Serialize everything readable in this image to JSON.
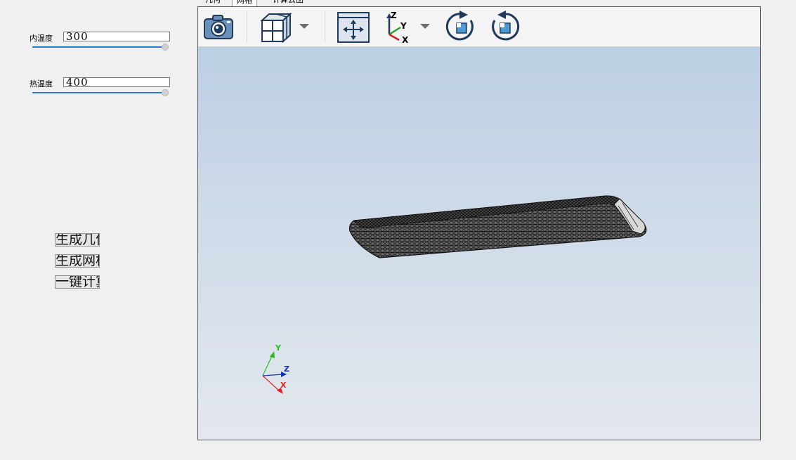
{
  "params": {
    "inner_temp": {
      "label": "内温度",
      "value": "300",
      "slider_level": 1.0
    },
    "hot_temp": {
      "label": "热温度",
      "value": "400",
      "slider_level": 1.0
    }
  },
  "buttons": {
    "generate_geometry": "生成几何",
    "generate_mesh": "生成网格",
    "one_click_compute": "一键计算"
  },
  "tabs": [
    "几何",
    "网格",
    "计算云图"
  ],
  "active_tab": 1,
  "toolbar": {
    "icons": [
      "camera-icon",
      "view-cube-icon",
      "dropdown-icon",
      "fit-view-icon",
      "axes-icon",
      "dropdown-icon",
      "rotate-cw-icon",
      "rotate-ccw-icon"
    ]
  },
  "axes": {
    "x": "X",
    "y": "Y",
    "z": "Z"
  },
  "colors": {
    "accent": "#2a7ac8",
    "axis_x": "#e02020",
    "axis_y": "#20c020",
    "axis_z": "#1030c0",
    "icon": "#1e3a5c"
  }
}
